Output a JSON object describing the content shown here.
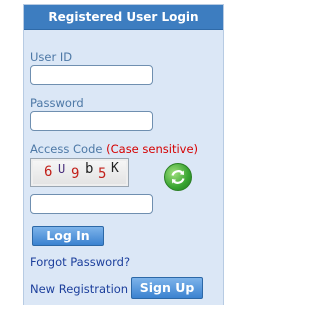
{
  "login": {
    "title": "Registered User Login",
    "user_id_label": "User ID",
    "password_label": "Password",
    "access_code_label": "Access Code",
    "case_note": "(Case sensitive)",
    "captcha_chars": [
      "6",
      "U",
      "9",
      "b",
      "5",
      "K"
    ],
    "login_button": "Log In",
    "forgot_password": "Forgot Password?",
    "new_registration": "New Registration",
    "signup_button": "Sign Up"
  },
  "colors": {
    "header": "#3d7dc0",
    "panel": "#dbe7f6",
    "label": "#4d78a6",
    "case_note": "#d60000",
    "link": "#1c3f9c",
    "button": "#3b82d0"
  },
  "icons": {
    "refresh": "refresh-icon"
  }
}
